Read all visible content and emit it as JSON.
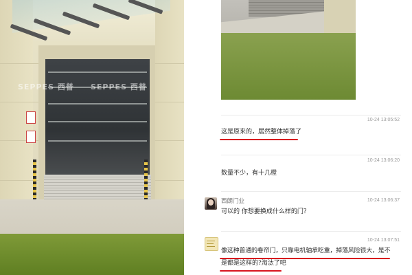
{
  "left_photo": {
    "watermark_1": "SEPPES 西普",
    "watermark_2": "SEPPES 西普"
  },
  "chat": {
    "messages": [
      {
        "sender": "",
        "timestamp": "10-24 13:05:52",
        "text": "这是原来的，居然整体掉落了",
        "highlighted": true
      },
      {
        "sender": "",
        "timestamp": "10-24 13:06:20",
        "text": "数量不少，有十几樘",
        "highlighted": false
      },
      {
        "sender": "西朗门业",
        "timestamp": "10-24 13:06:37",
        "text": "可以的   你想要换成什么样的门？",
        "highlighted": false
      },
      {
        "sender": "",
        "timestamp": "10-24 13:07:51",
        "text_line1": "像这种普通的卷帘门，只靠电机轴承吃重，掉落风险很大，是不",
        "text_line2": "是都是这样的?淘汰了吧",
        "highlighted": true
      }
    ],
    "highlight_color": "#d8141e"
  }
}
